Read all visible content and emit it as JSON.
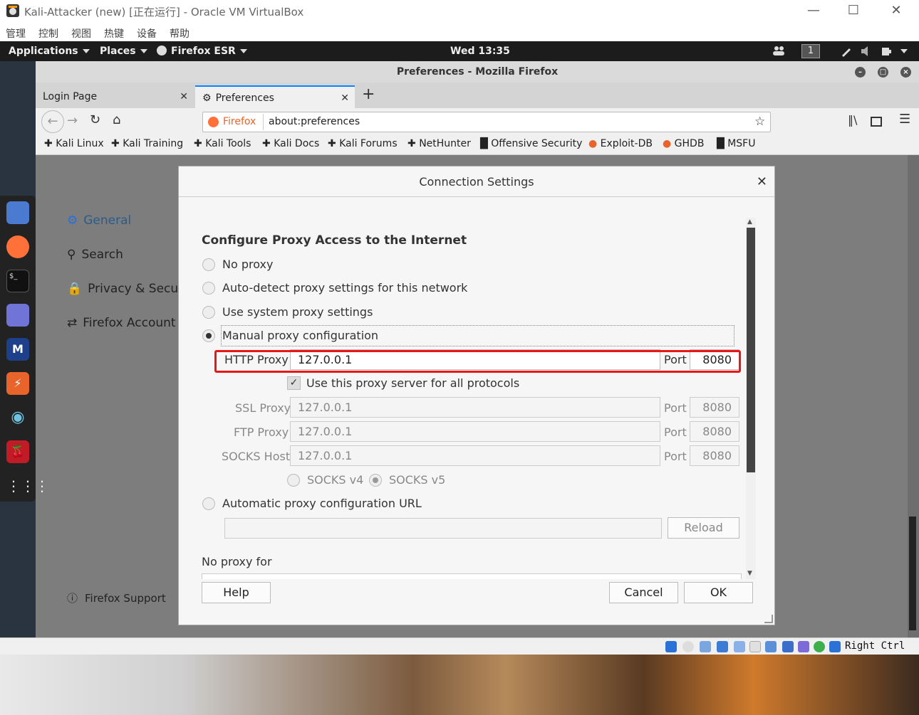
{
  "vbox": {
    "title": "Kali-Attacker (new) [正在运行] - Oracle VM VirtualBox",
    "menu": [
      "管理",
      "控制",
      "视图",
      "热键",
      "设备",
      "帮助"
    ],
    "host_key": "Right Ctrl"
  },
  "kali_panel": {
    "applications": "Applications",
    "places": "Places",
    "firefox": "Firefox ESR",
    "clock": "Wed 13:35",
    "workspace": "1"
  },
  "firefox": {
    "window_title": "Preferences - Mozilla Firefox",
    "tabs": [
      {
        "label": "Login Page"
      },
      {
        "label": "Preferences"
      }
    ],
    "url_identity": "Firefox",
    "url": "about:preferences",
    "bookmarks": [
      "Kali Linux",
      "Kali Training",
      "Kali Tools",
      "Kali Docs",
      "Kali Forums",
      "NetHunter",
      "Offensive Security",
      "Exploit-DB",
      "GHDB",
      "MSFU"
    ],
    "sidebar": {
      "general": "General",
      "search": "Search",
      "privacy": "Privacy & Securi",
      "account": "Firefox Account",
      "support": "Firefox Support"
    }
  },
  "dialog": {
    "title": "Connection Settings",
    "heading": "Configure Proxy Access to the Internet",
    "options": {
      "no_proxy": "No proxy",
      "auto_detect": "Auto-detect proxy settings for this network",
      "system": "Use system proxy settings",
      "manual": "Manual proxy configuration",
      "auto_url": "Automatic proxy configuration URL"
    },
    "http_label": "HTTP Proxy",
    "http_value": "127.0.0.1",
    "http_port": "8080",
    "port_label": "Port",
    "use_all": "Use this proxy server for all protocols",
    "ssl_label": "SSL Proxy",
    "ssl_value": "127.0.0.1",
    "ssl_port": "8080",
    "ftp_label": "FTP Proxy",
    "ftp_value": "127.0.0.1",
    "ftp_port": "8080",
    "socks_label": "SOCKS Host",
    "socks_value": "127.0.0.1",
    "socks_port": "8080",
    "socks4": "SOCKS v4",
    "socks5": "SOCKS v5",
    "reload": "Reload",
    "no_proxy_for": "No proxy for",
    "help": "Help",
    "cancel": "Cancel",
    "ok": "OK"
  },
  "colors": {
    "highlight": "#e81818",
    "kali_panel": "#1c1c1c",
    "firefox_orange": "#ff7139"
  }
}
